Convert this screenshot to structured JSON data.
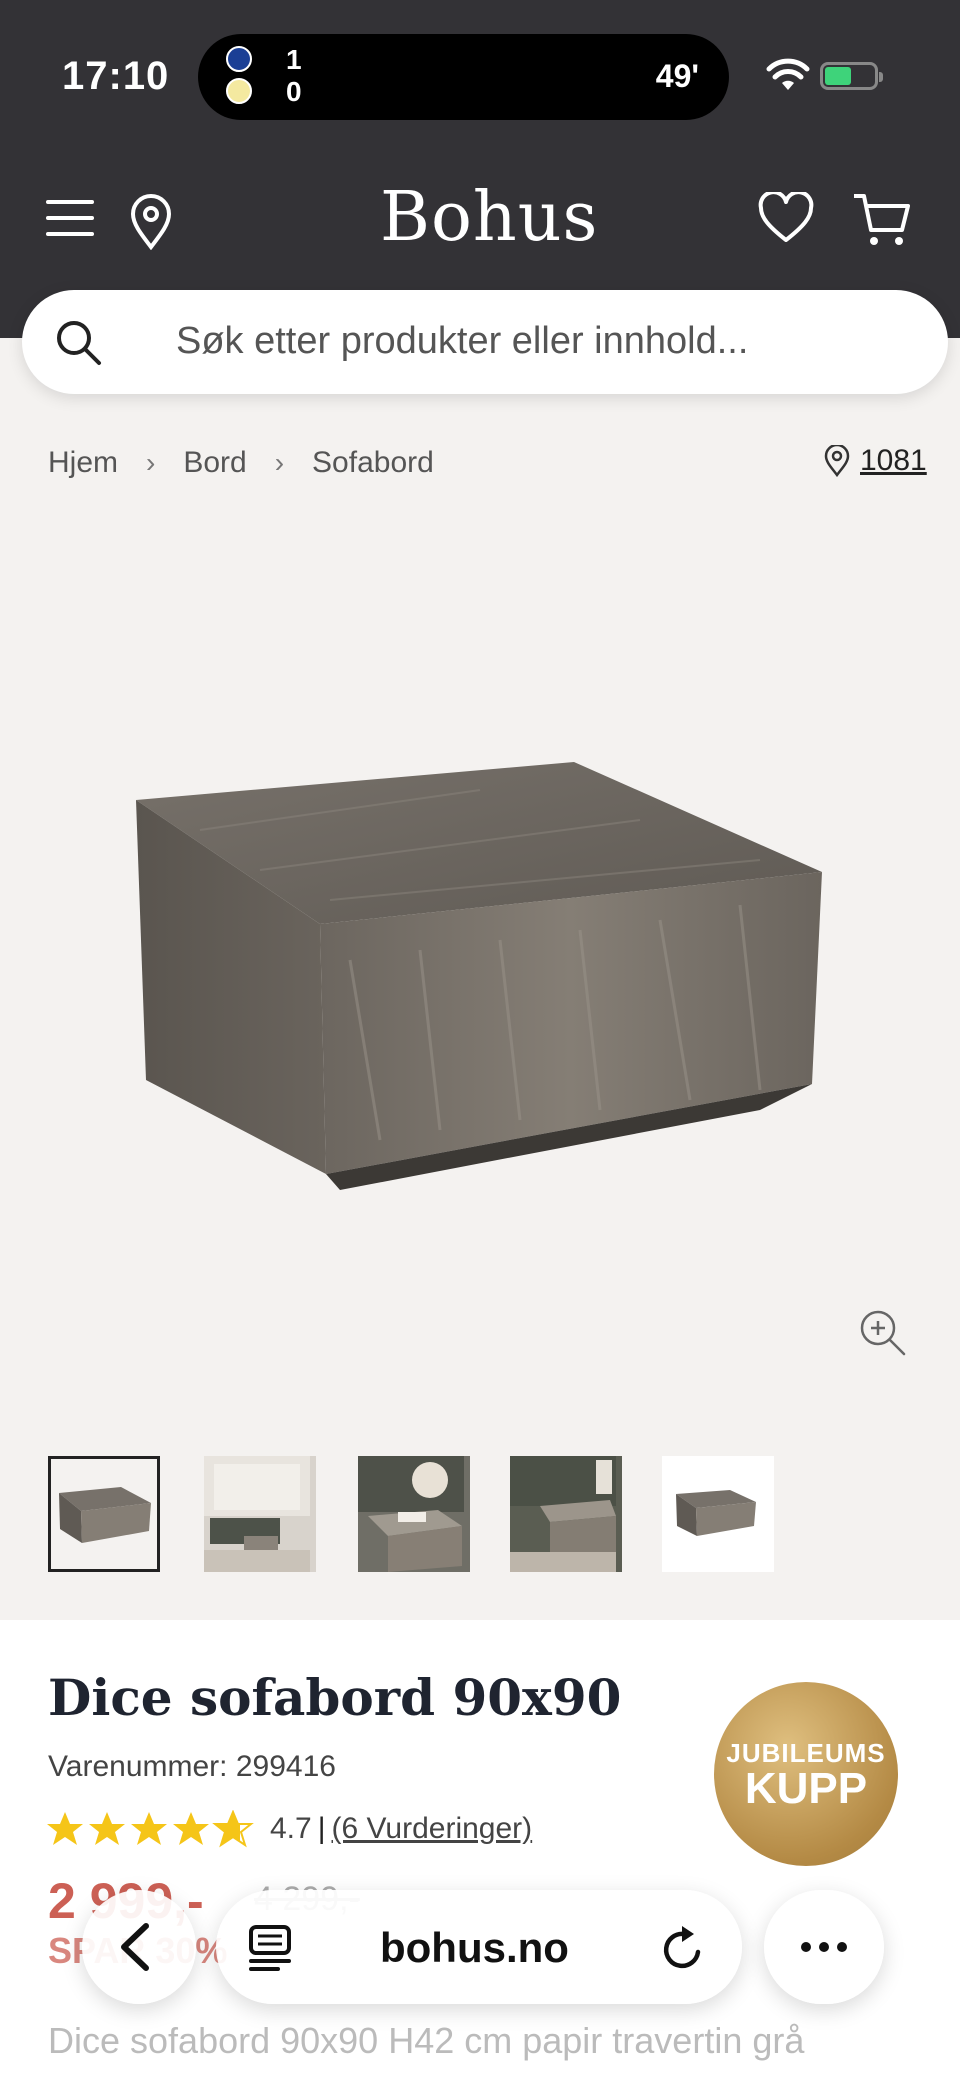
{
  "status": {
    "time": "17:10",
    "score_home": "1",
    "score_away": "0",
    "minute": "49'"
  },
  "header": {
    "logo": "Bohus",
    "search_placeholder": "Søk etter produkter eller innhold..."
  },
  "breadcrumb": {
    "items": [
      "Hjem",
      "Bord",
      "Sofabord"
    ],
    "store_number": "1081"
  },
  "product": {
    "title": "Dice sofabord 90x90",
    "sku": "Varenummer: 299416",
    "rating": "4.7",
    "reviews": "(6 Vurderinger)",
    "price": "2 999,-",
    "old_price": "4 299,-",
    "save": "SPAR 30%",
    "description": "Dice sofabord 90x90 H42 cm papir travertin grå",
    "badge_line1": "JUBILEUMS",
    "badge_line2": "KUPP"
  },
  "browser": {
    "url": "bohus.no"
  },
  "colors": {
    "header_bg": "#333236",
    "price": "#c0392b",
    "badge": "#b48a45"
  },
  "icons": [
    "menu-icon",
    "location-pin-icon",
    "heart-icon",
    "cart-icon",
    "search-icon",
    "zoom-icon",
    "star-icon",
    "back-icon",
    "reader-icon",
    "reload-icon",
    "more-icon"
  ]
}
